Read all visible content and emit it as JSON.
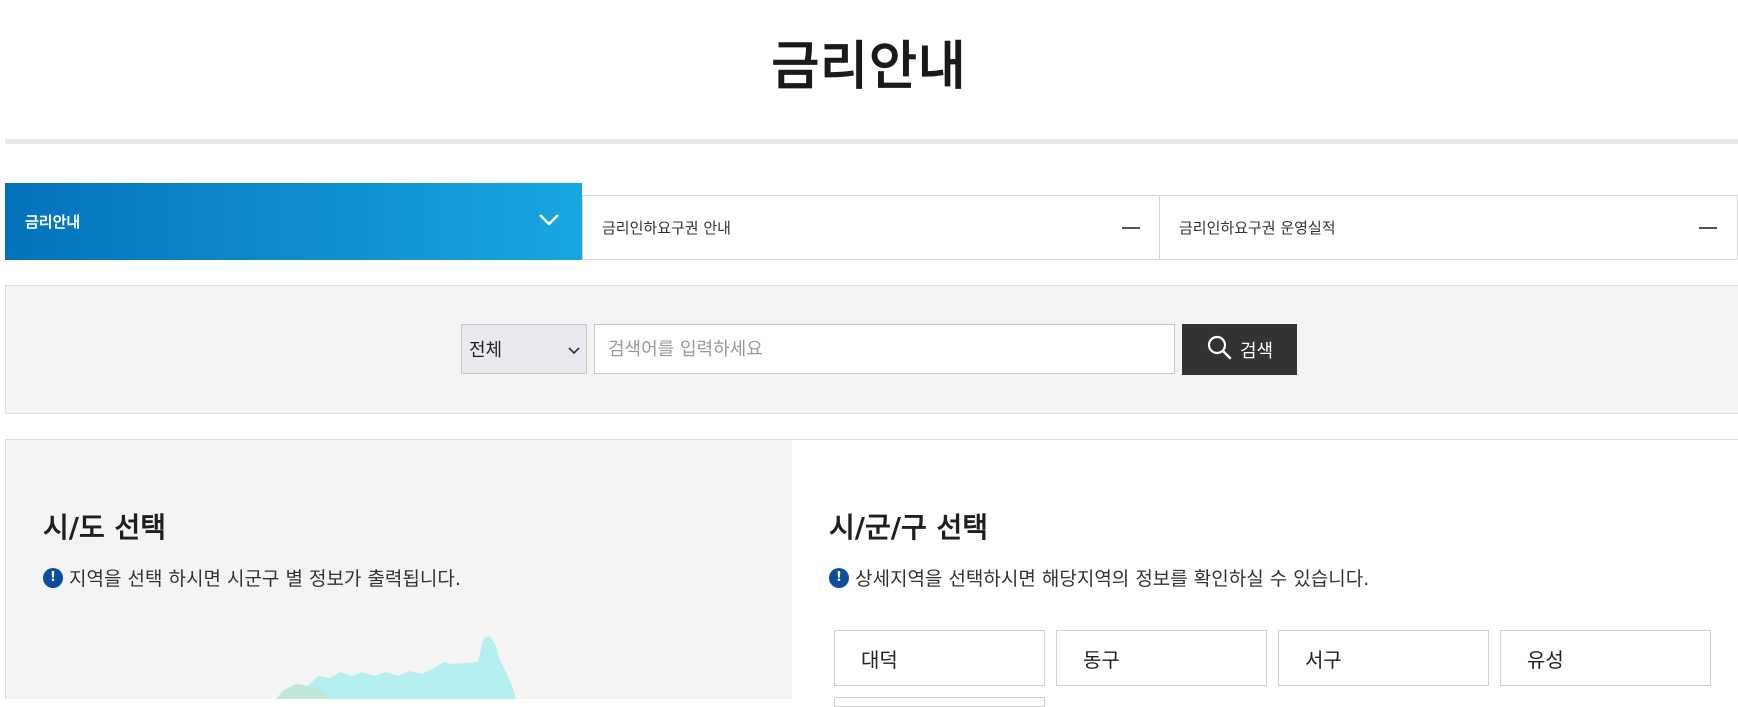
{
  "page": {
    "title": "금리안내"
  },
  "tabs": [
    {
      "label": "금리안내",
      "state": "expanded",
      "icon": "chevron-down-icon"
    },
    {
      "label": "금리인하요구권 안내",
      "state": "collapsed",
      "icon": "minus-icon"
    },
    {
      "label": "금리인하요구권 운영실적",
      "state": "collapsed",
      "icon": "minus-icon"
    }
  ],
  "search": {
    "select_value": "전체",
    "input_value": "",
    "placeholder": "검색어를 입력하세요",
    "button_label": "검색",
    "button_icon": "search-icon"
  },
  "left_panel": {
    "title": "시/도 선택",
    "notice": "지역을 선택 하시면 시군구 별 정보가 출력됩니다.",
    "notice_icon": "exclamation-icon"
  },
  "right_panel": {
    "title": "시/군/구 선택",
    "notice": "상세지역을 선택하시면 해당지역의 정보를 확인하실 수 있습니다.",
    "notice_icon": "exclamation-icon",
    "districts": [
      "대덕",
      "동구",
      "서구",
      "유성"
    ]
  },
  "colors": {
    "active_tab_start": "#0472bb",
    "active_tab_end": "#18a7e0",
    "search_button": "#333333",
    "info_icon": "#0c4e9c",
    "map_fill": "#b4f0f0"
  }
}
